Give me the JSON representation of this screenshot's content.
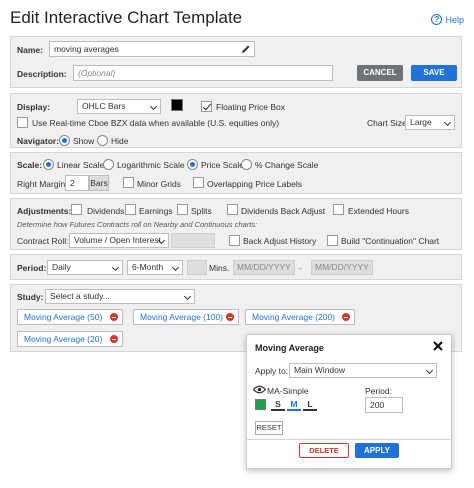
{
  "page": {
    "title": "Edit Interactive Chart Template",
    "help_label": "Help",
    "help_icon": "question-circle-icon"
  },
  "header_form": {
    "name_label": "Name:",
    "name_value": "moving averages",
    "edit_icon": "pencil-icon",
    "description_label": "Description:",
    "description_placeholder": "(Optional)",
    "cancel_label": "CANCEL",
    "save_label": "SAVE"
  },
  "display": {
    "label": "Display:",
    "chart_type": "OHLC Bars",
    "color": "#000000",
    "floating_price_box_label": "Floating Price Box",
    "floating_price_box_checked": true,
    "realtime_label": "Use Real-time Cboe BZX data when available (U.S. equities only)",
    "realtime_checked": false,
    "chart_size_label": "Chart Size:",
    "chart_size_value": "Large"
  },
  "navigator": {
    "label": "Navigator:",
    "show_label": "Show",
    "hide_label": "Hide",
    "selected": "Show"
  },
  "scale": {
    "label": "Scale:",
    "linear_label": "Linear Scale",
    "log_label": "Logarithmic Scale",
    "scale_selected": "Linear Scale",
    "price_label": "Price Scale",
    "pct_label": "% Change Scale",
    "price_selected": "Price Scale",
    "right_margin_label": "Right Margin",
    "right_margin_value": "2",
    "right_margin_unit": "Bars",
    "minor_grids_label": "Minor Grids",
    "overlap_label": "Overlapping Price Labels"
  },
  "adjustments": {
    "label": "Adjustments:",
    "dividends": "Dividends",
    "earnings": "Earnings",
    "splits": "Splits",
    "dividends_back": "Dividends Back Adjust",
    "extended_hours": "Extended Hours",
    "futures_note": "Determine how Futures Contracts roll on Nearby and Continuous charts:",
    "contract_roll_label": "Contract Roll:",
    "contract_roll_value": "Volume / Open Interest",
    "back_adjust_history": "Back Adjust History",
    "build_continuation": "Build \"Continuation\" Chart"
  },
  "period": {
    "label": "Period:",
    "period_value": "Daily",
    "range_value": "6-Month",
    "mins_label": "Mins.",
    "date_from_placeholder": "MM/DD/YYYY",
    "date_sep": "-",
    "date_to_placeholder": "MM/DD/YYYY"
  },
  "study": {
    "label": "Study:",
    "select_placeholder": "Select a study...",
    "chips": [
      "Moving Average (50)",
      "Moving Average (100)",
      "Moving Average (200)",
      "Moving Average (20)"
    ],
    "remove_icon": "minus-circle-icon"
  },
  "popup": {
    "title": "Moving Average",
    "close_icon": "close-icon",
    "apply_to_label": "Apply to:",
    "apply_to_value": "Main Window",
    "eye_icon": "eye-icon",
    "series_name": "MA-Simple",
    "series_color": "#1aa34a",
    "sizes": [
      "S",
      "M",
      "L"
    ],
    "size_selected": "M",
    "period_label": "Period:",
    "period_value": "200",
    "reset_label": "RESET",
    "delete_label": "DELETE",
    "apply_label": "APPLY"
  },
  "colors": {
    "accent": "#1f73d8",
    "danger": "#d9332a"
  }
}
